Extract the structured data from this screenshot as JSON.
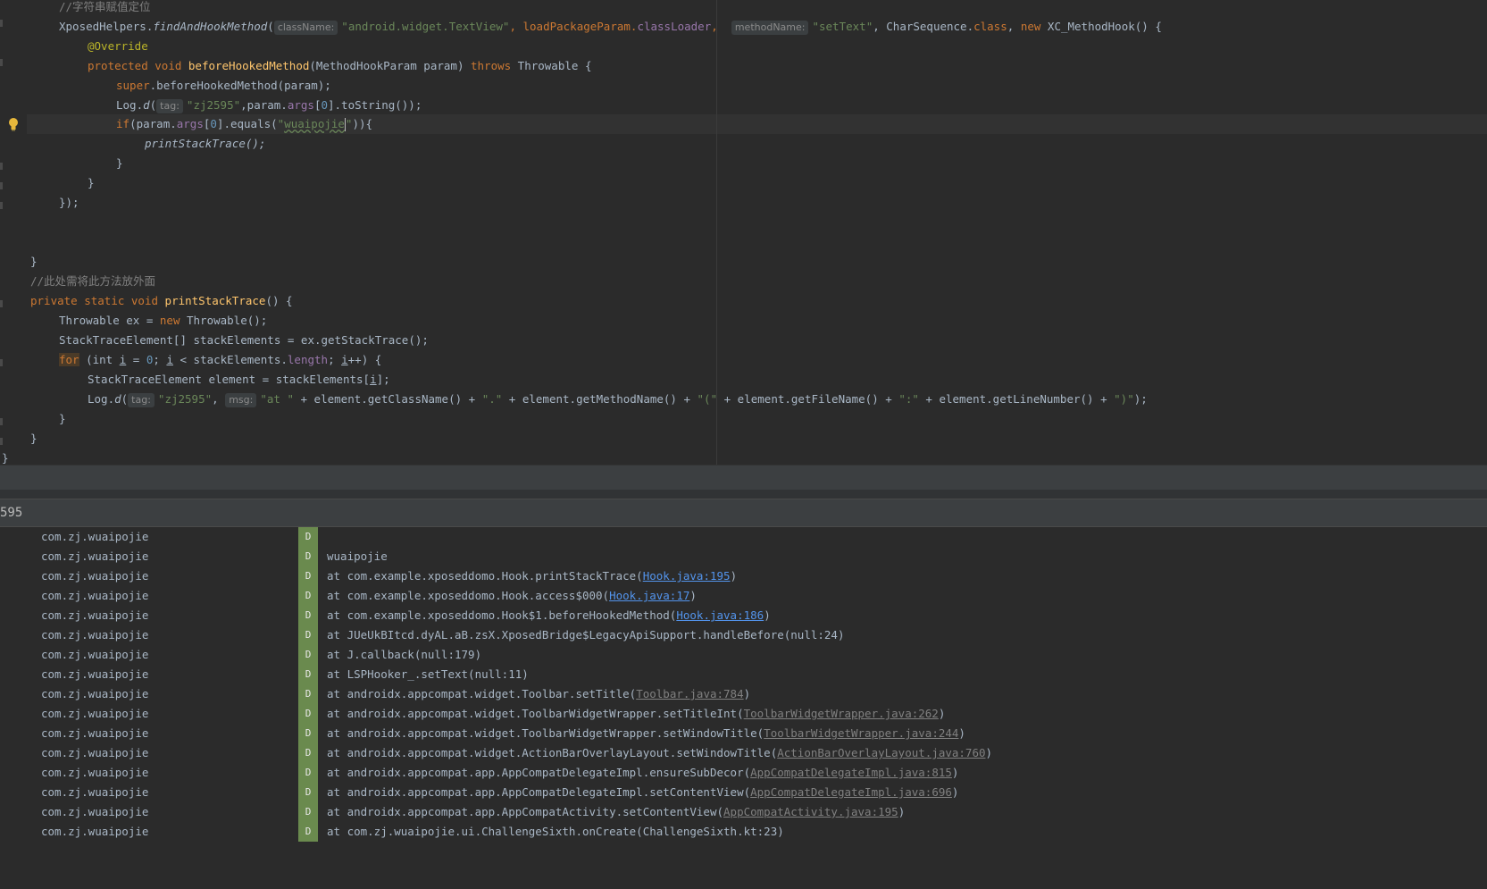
{
  "editor": {
    "comment_top": "//字符串赋值定位",
    "l1": {
      "pre": "XposedHelpers.",
      "method": "findAndHookMethod",
      "open": "(",
      "hint_classname": "className:",
      "classname": "\"android.widget.TextView\"",
      "mid1": ", loadPackageParam.",
      "classloader": "classLoader",
      "comma": ",",
      "hint_methodname": "methodName:",
      "methodname": "\"setText\"",
      "mid2": ", CharSequence.",
      "class_kw": "class",
      "mid3": ", ",
      "new_kw": "new",
      "tail": " XC_MethodHook() {"
    },
    "l2": "@Override",
    "l3": {
      "protected": "protected",
      "void": "void",
      "name": "beforeHookedMethod",
      "params": "(MethodHookParam param) ",
      "throws": "throws",
      "tail": " Throwable {"
    },
    "l4": {
      "super": "super",
      "rest": ".beforeHookedMethod(param);"
    },
    "l5": {
      "pre": "Log.",
      "d": "d",
      "open": "(",
      "hint_tag": "tag:",
      "tag": "\"zj2595\"",
      "mid": ",param.",
      "args": "args",
      "idx_open": "[",
      "idx": "0",
      "idx_close": "].toString());"
    },
    "l6": {
      "if": "if",
      "pre": "(param.",
      "args": "args",
      "b1": "[",
      "idx": "0",
      "b2": "].equals(",
      "q1": "\"",
      "str": "wuaipojie",
      "q2": "\"",
      "tail": ")){"
    },
    "l7": "printStackTrace();",
    "l8": "}",
    "l9": "}",
    "l10": "});",
    "l11": "}",
    "comment2": "//此处需将此方法放外面",
    "l12": {
      "private": "private",
      "static": "static",
      "void": "void",
      "name": "printStackTrace",
      "tail": "() {"
    },
    "l13": {
      "pre": "Throwable ex = ",
      "new": "new",
      "tail": " Throwable();"
    },
    "l14": "StackTraceElement[] stackElements = ex.getStackTrace();",
    "l15": {
      "for": "for",
      "p1": " (int ",
      "i1": "i",
      "p2": " = ",
      "zero": "0",
      "p3": "; ",
      "i2": "i",
      "p4": " < stackElements.",
      "length": "length",
      "p5": "; ",
      "i3": "i",
      "p6": "++) {"
    },
    "l16": {
      "pre": "StackTraceElement element = stackElements[",
      "i": "i",
      "tail": "];"
    },
    "l17": {
      "pre": "Log.",
      "d": "d",
      "open": "(",
      "hint_tag": "tag:",
      "tag": "\"zj2595\"",
      "c1": ", ",
      "hint_msg": "msg:",
      "at": "\"at \"",
      "p1": " + element.getClassName() + ",
      "dot": "\".\"",
      "p2": " + element.getMethodName() + ",
      "paren": "\"(\"",
      "p3": " + element.getFileName() + ",
      "colon": "\":\"",
      "p4": " + element.getLineNumber() + ",
      "close": "\")\"",
      "tail": ");"
    },
    "l18": "}",
    "l19": "}",
    "l20": "}"
  },
  "filter": {
    "text": "595"
  },
  "logcat": {
    "level": "D",
    "package": "com.zj.wuaipojie",
    "rows": [
      {
        "pre": "",
        "link": "",
        "post": "",
        "style": ""
      },
      {
        "pre": "wuaipojie",
        "link": "",
        "post": "",
        "style": ""
      },
      {
        "pre": "at com.example.xposeddomo.Hook.printStackTrace(",
        "link": "Hook.java:195",
        "post": ")",
        "style": "blue"
      },
      {
        "pre": "at com.example.xposeddomo.Hook.access$000(",
        "link": "Hook.java:17",
        "post": ")",
        "style": "blue"
      },
      {
        "pre": "at com.example.xposeddomo.Hook$1.beforeHookedMethod(",
        "link": "Hook.java:186",
        "post": ")",
        "style": "blue"
      },
      {
        "pre": "at JUeUkBItcd.dyAL.aB.zsX.XposedBridge$LegacyApiSupport.handleBefore(null:24)",
        "link": "",
        "post": "",
        "style": ""
      },
      {
        "pre": "at J.callback(null:179)",
        "link": "",
        "post": "",
        "style": ""
      },
      {
        "pre": "at LSPHooker_.setText(null:11)",
        "link": "",
        "post": "",
        "style": ""
      },
      {
        "pre": "at androidx.appcompat.widget.Toolbar.setTitle(",
        "link": "Toolbar.java:784",
        "post": ")",
        "style": "gray"
      },
      {
        "pre": "at androidx.appcompat.widget.ToolbarWidgetWrapper.setTitleInt(",
        "link": "ToolbarWidgetWrapper.java:262",
        "post": ")",
        "style": "gray"
      },
      {
        "pre": "at androidx.appcompat.widget.ToolbarWidgetWrapper.setWindowTitle(",
        "link": "ToolbarWidgetWrapper.java:244",
        "post": ")",
        "style": "gray"
      },
      {
        "pre": "at androidx.appcompat.widget.ActionBarOverlayLayout.setWindowTitle(",
        "link": "ActionBarOverlayLayout.java:760",
        "post": ")",
        "style": "gray"
      },
      {
        "pre": "at androidx.appcompat.app.AppCompatDelegateImpl.ensureSubDecor(",
        "link": "AppCompatDelegateImpl.java:815",
        "post": ")",
        "style": "gray"
      },
      {
        "pre": "at androidx.appcompat.app.AppCompatDelegateImpl.setContentView(",
        "link": "AppCompatDelegateImpl.java:696",
        "post": ")",
        "style": "gray"
      },
      {
        "pre": "at androidx.appcompat.app.AppCompatActivity.setContentView(",
        "link": "AppCompatActivity.java:195",
        "post": ")",
        "style": "gray"
      },
      {
        "pre": "at com.zj.wuaipojie.ui.ChallengeSixth.onCreate(ChallengeSixth.kt:23)",
        "link": "",
        "post": "",
        "style": ""
      }
    ]
  }
}
